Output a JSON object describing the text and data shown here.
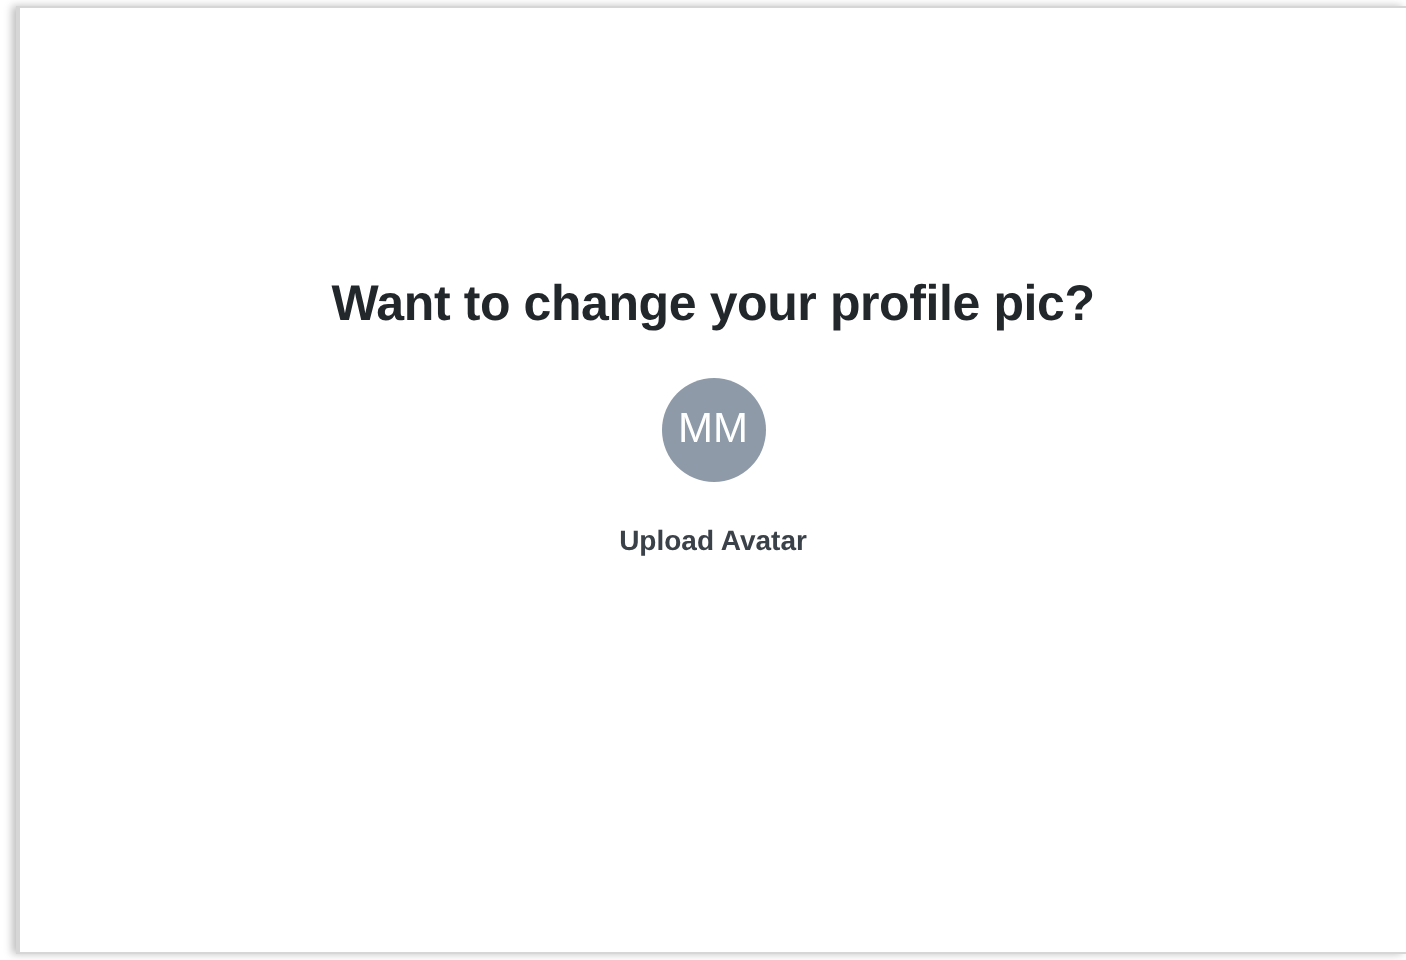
{
  "heading": "Want to change your profile pic?",
  "avatar": {
    "initials": "MM"
  },
  "upload_button": "Upload Avatar"
}
